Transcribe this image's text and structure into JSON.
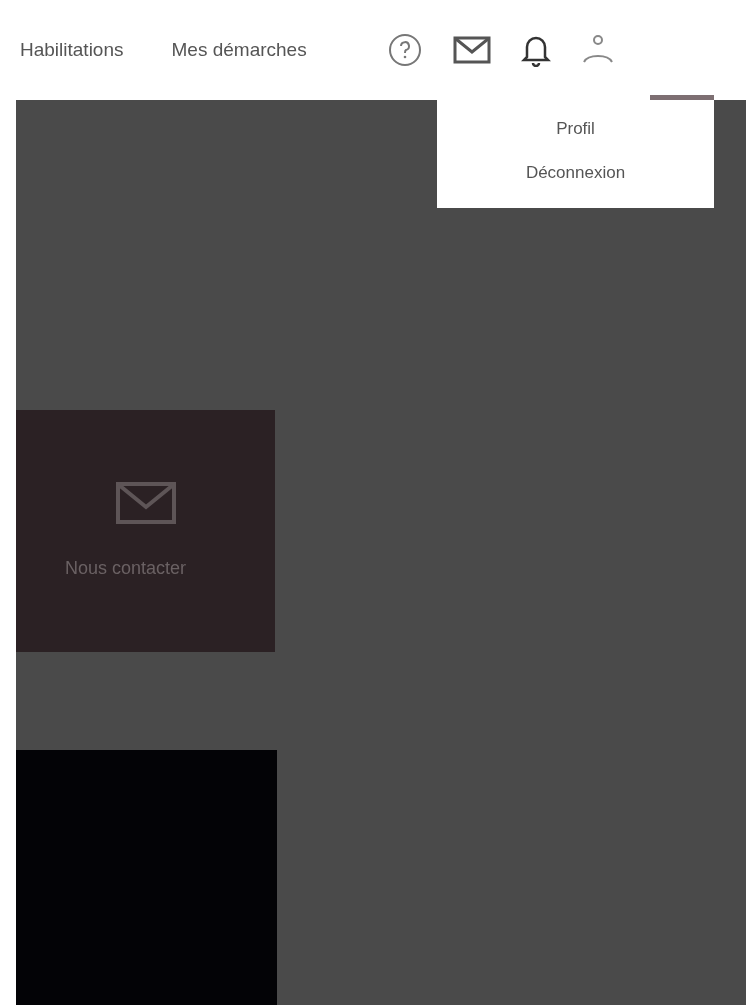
{
  "nav": [
    {
      "label": "Habilitations"
    },
    {
      "label": "Mes démarches"
    }
  ],
  "user_menu": {
    "items": [
      {
        "label": "Profil"
      },
      {
        "label": "Déconnexion"
      }
    ]
  },
  "contact_card": {
    "label": "Nous contacter"
  }
}
